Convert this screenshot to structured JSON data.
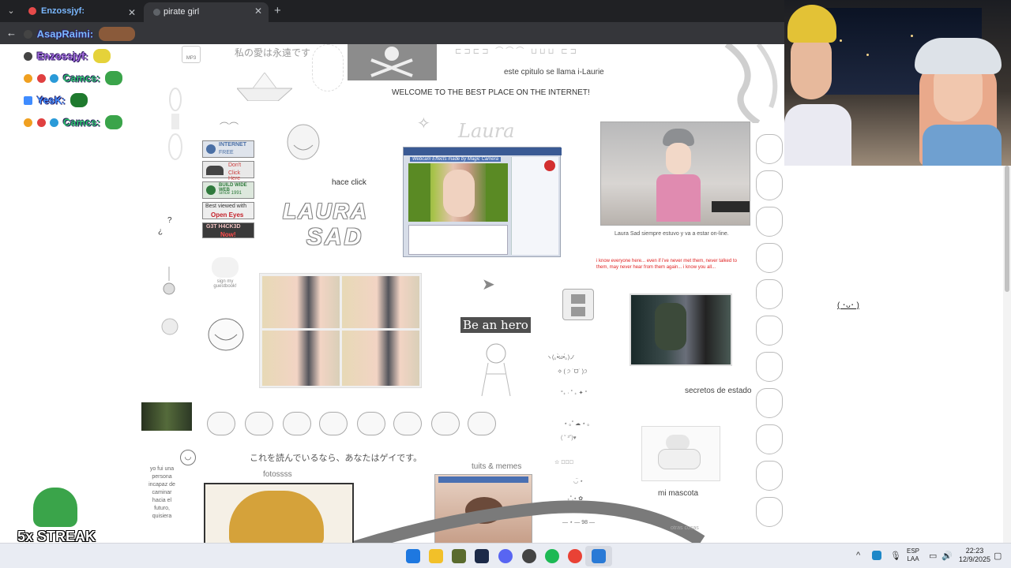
{
  "browser": {
    "tabs": [
      {
        "label": "Enzossjyf:",
        "active": false
      },
      {
        "label": "pirate girl",
        "active": true
      }
    ],
    "close_glyph": "✕",
    "new_tab_glyph": "+",
    "back_glyph": "←",
    "menu_glyph": "⌄"
  },
  "overlay": {
    "chat": [
      {
        "name": "AsapRaimi:",
        "color": "#7ab8ff"
      },
      {
        "name": "Enzossjyf:",
        "color": "#a46be0"
      },
      {
        "name": "Camcs:",
        "color": "#29c46a"
      },
      {
        "name": "YesK:",
        "color": "#3f8cff"
      },
      {
        "name": "Camcs:",
        "color": "#29c46a"
      }
    ],
    "streak": "5x STREAK"
  },
  "page": {
    "jp_top": "私の愛は永遠です",
    "mp3": "MP3",
    "chapter": "este cpitulo se llama i-Laurie",
    "welcome": "WELCOME TO THE BEST PLACE ON THE INTERNET!",
    "hace_click": "hace click",
    "laura_cursive": "Laura",
    "logo_laura": "LAURA",
    "logo_sad": "SAD",
    "cam_caption": "Laura Sad siempre estuvo y va a estar on-line.",
    "red_text": "i know everyone here... even if i've never met them, never talked to them, may never hear from them again... i know you all...",
    "be_an_hero": "Be an hero",
    "secretos": "secretos de estado",
    "mi_mascota": "mi mascota",
    "otras_cosas": "otras cosas",
    "jp_bottom": "これを読んでいるなら、あなたはゲイです。",
    "fotos": "fotossss",
    "tuits": "tuits & memes",
    "guestbook": "sign my guestbook!",
    "question": "?",
    "inv_question": "¿",
    "vertical_text": "yo fui una persona incapaz de caminar hacia el futuro, quisiera",
    "webcam_title": "Webcam Effects made by Magic Camera",
    "badges": [
      {
        "l1": "INTERNET",
        "l2": "FREE",
        "color": "#4a6fa5"
      },
      {
        "l1": "Don't",
        "l2": "Click Here",
        "color": "#cc3b3b"
      },
      {
        "l1": "BUILD WIDE WEB",
        "l2": "since 1991",
        "color": "#2f7a3c"
      },
      {
        "l1": "Best viewed with",
        "l2": "Open Eyes",
        "color": "#c4222b"
      },
      {
        "l1": "G3T H4CK3D",
        "l2": "Now!",
        "color": "#a01c1c"
      }
    ],
    "right_face": "( ･ᴗ･ )",
    "ascii_rows": [
      "ヽ(｡•̀ω•́｡)ノ",
      "✧ ( ੭ ˙ᗜ˙ )੭",
      "°₊ · ˚ ₊ ✦ °",
      "⋆ ｡˚ ☁ ⋆ ｡",
      "( ˘ ³˘)♥",
      "☆ ﾟ。・",
      "◡̈ ⋆",
      "₊˚.⋆ ✿",
      "— ⋆ — 98 —"
    ]
  },
  "taskbar": {
    "lang_top": "ESP",
    "lang_bottom": "LAA",
    "time": "22:23",
    "date": "12/9/2025",
    "tray_up": "^",
    "icons": [
      {
        "name": "windows-start-icon",
        "color": "#1e78e0"
      },
      {
        "name": "file-explorer-icon",
        "color": "#f2c029"
      },
      {
        "name": "xbox-icon",
        "color": "#5a6b2e"
      },
      {
        "name": "steam-icon",
        "color": "#1c2a48"
      },
      {
        "name": "discord-icon",
        "color": "#5865f2"
      },
      {
        "name": "obs-icon",
        "color": "#444444"
      },
      {
        "name": "spotify-icon",
        "color": "#1db954"
      },
      {
        "name": "chrome-icon",
        "color": "#e94235"
      },
      {
        "name": "app-active-icon",
        "color": "#2a7ad6"
      }
    ]
  }
}
